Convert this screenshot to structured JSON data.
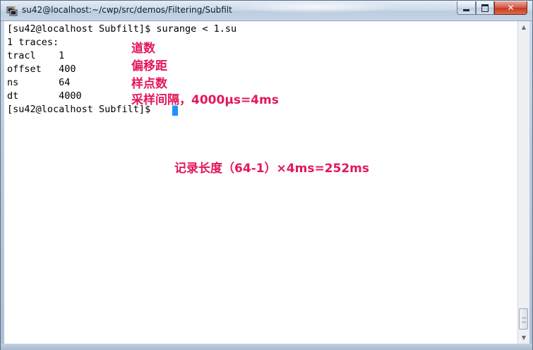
{
  "window": {
    "title": "su42@localhost:~/cwp/src/demos/Filtering/Subfilt",
    "icon": "putty-terminal-icon",
    "controls": {
      "minimize": "minimize-icon",
      "maximize": "maximize-icon",
      "close": "close-icon"
    }
  },
  "terminal": {
    "lines": [
      "[su42@localhost Subfilt]$ surange < 1.su",
      "1 traces:",
      "tracl    1",
      "offset   400",
      "ns       64",
      "dt       4000",
      "[su42@localhost Subfilt]$ "
    ],
    "cursor_color": "#1e90ff"
  },
  "annotations": {
    "tracl_note": "道数",
    "offset_note": "偏移距",
    "ns_note": "样点数",
    "dt_note": "采样间隔，4000μs=4ms",
    "record_length_note": "记录长度（64-1）×4ms=252ms",
    "color": "#e3175c"
  },
  "scrollbar": {
    "up_icon": "scroll-up-arrow-icon",
    "down_icon": "scroll-down-arrow-icon"
  }
}
